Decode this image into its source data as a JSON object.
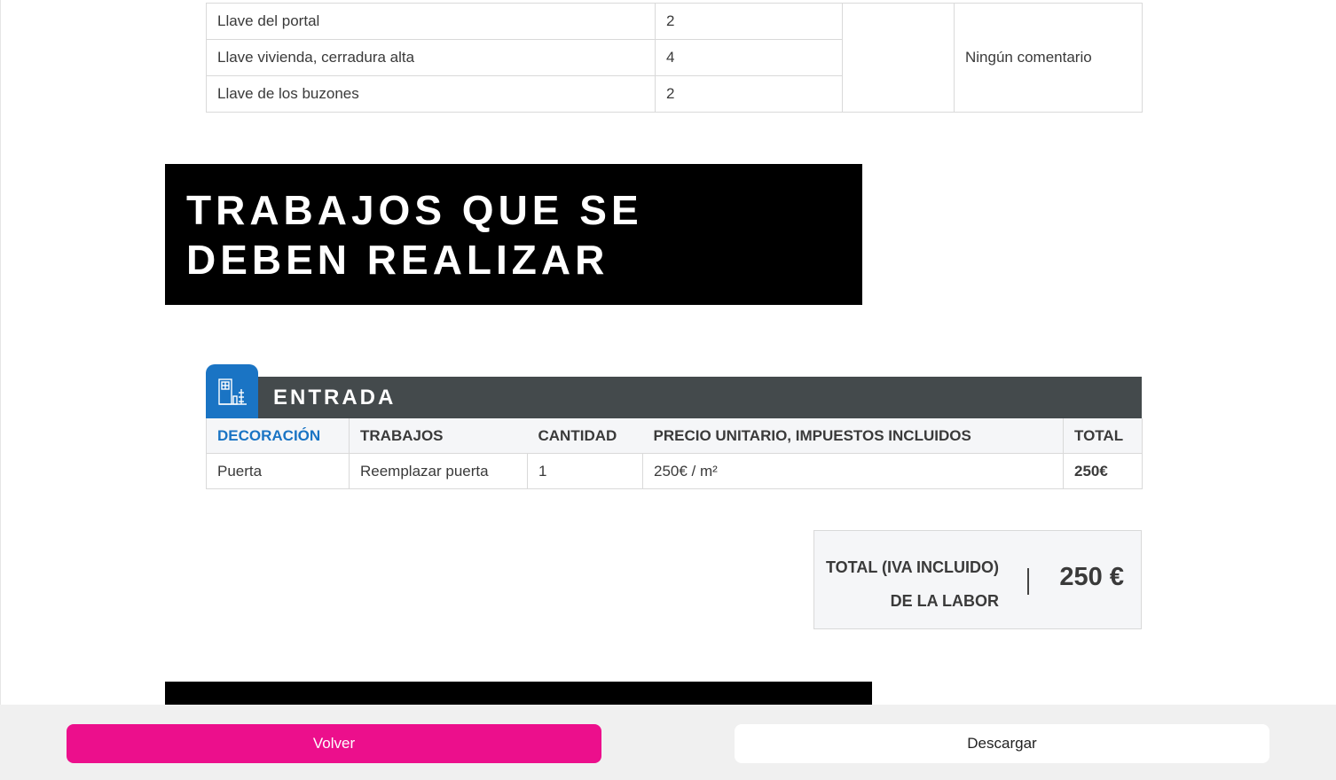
{
  "keys_table": {
    "rows": [
      {
        "name": "Llave del portal",
        "qty": "2"
      },
      {
        "name": "Llave vivienda, cerradura alta",
        "qty": "4"
      },
      {
        "name": "Llave de los buzones",
        "qty": "2"
      }
    ],
    "comment": "Ningún comentario"
  },
  "section": {
    "title": "TRABAJOS QUE SE DEBEN REALIZAR"
  },
  "category": {
    "name": "ENTRADA",
    "icon": "door-building-icon",
    "columns": [
      "DECORACIÓN",
      "TRABAJOS",
      "CANTIDAD",
      "PRECIO UNITARIO, IMPUESTOS INCLUIDOS",
      "TOTAL"
    ],
    "rows": [
      {
        "decoracion": "Puerta",
        "trabajos": "Reemplazar puerta",
        "cantidad": "1",
        "precio": "250€ / m²",
        "total": "250€"
      }
    ]
  },
  "total": {
    "label_line1": "TOTAL (IVA INCLUIDO)",
    "label_line2": "DE LA LABOR",
    "value": "250 €"
  },
  "footer": {
    "back_label": "Volver",
    "download_label": "Descargar"
  },
  "colors": {
    "accent_blue": "#1a74c4",
    "primary_pink": "#ec0f8c",
    "category_bar": "#444a4c"
  }
}
